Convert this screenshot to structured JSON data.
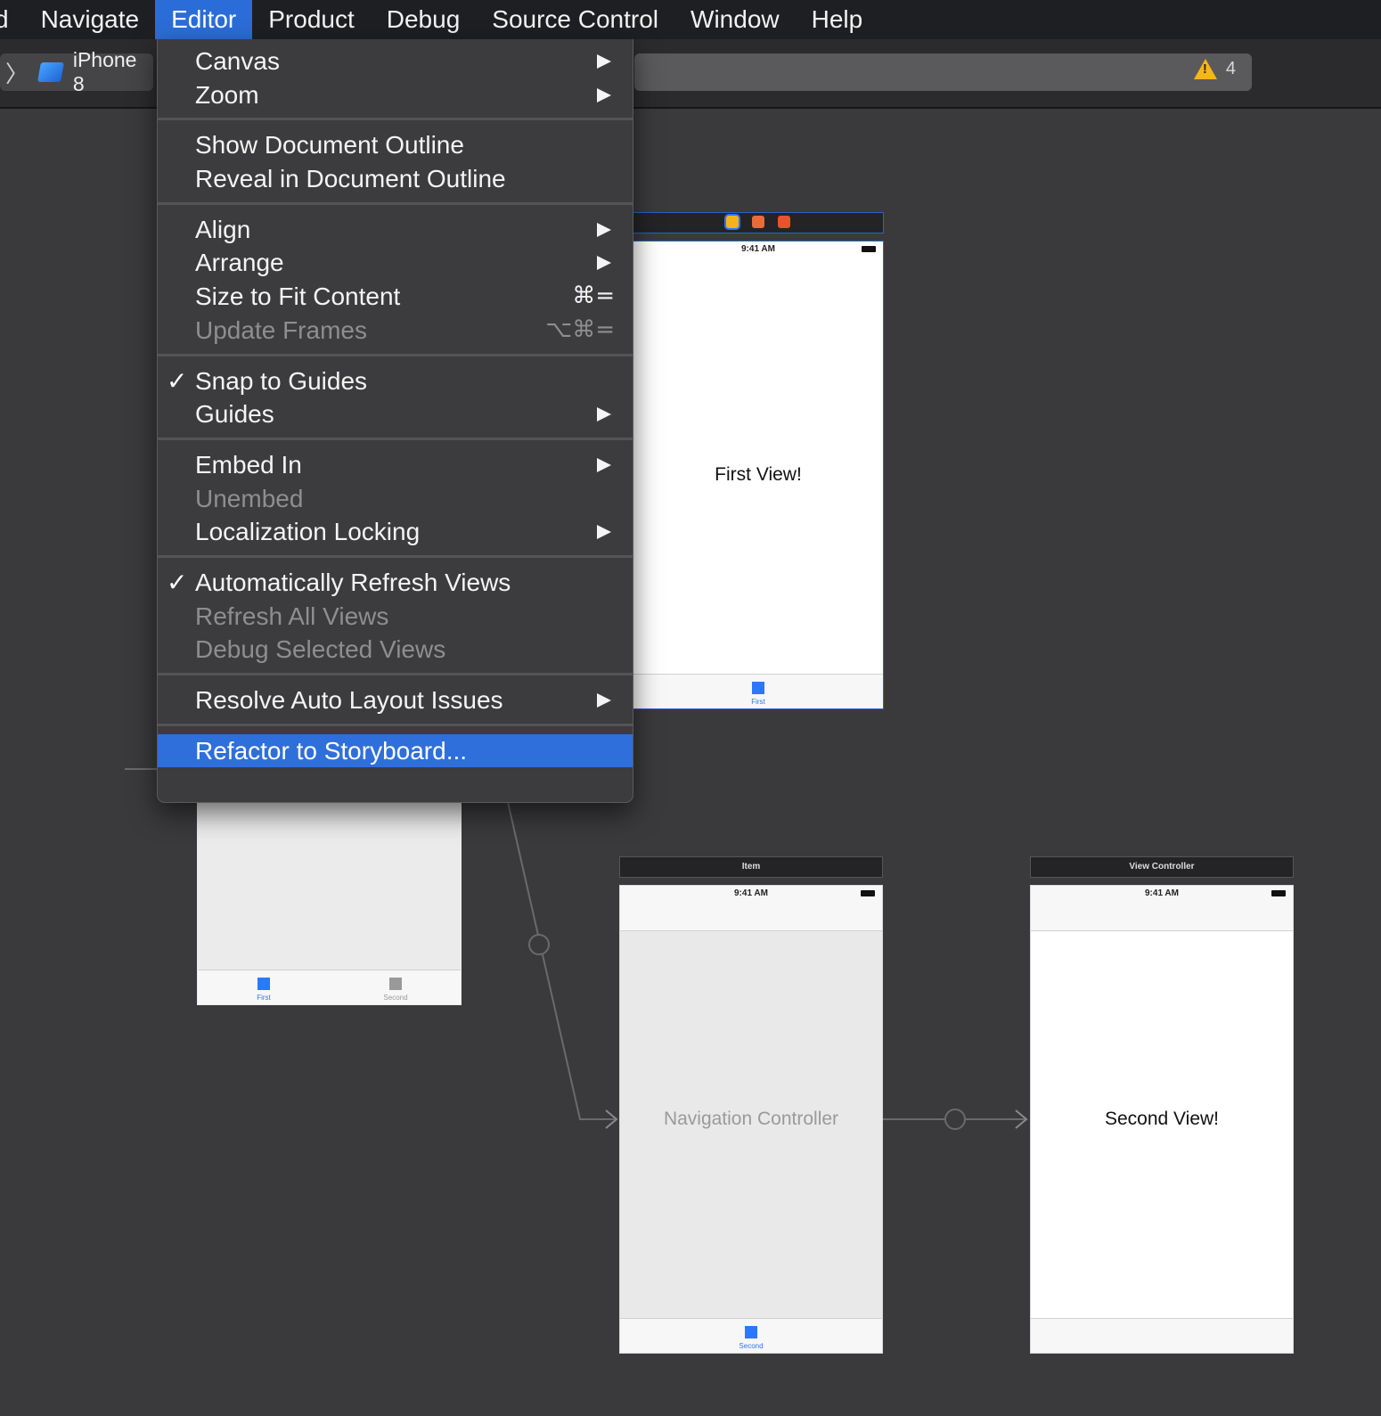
{
  "menubar": {
    "items": [
      {
        "label": "d"
      },
      {
        "label": "Navigate"
      },
      {
        "label": "Editor"
      },
      {
        "label": "Product"
      },
      {
        "label": "Debug"
      },
      {
        "label": "Source Control"
      },
      {
        "label": "Window"
      },
      {
        "label": "Help"
      }
    ]
  },
  "toolbar": {
    "scheme_device": "iPhone 8",
    "warning_count": "4",
    "warning_color": "#f5b617"
  },
  "editor_menu": {
    "canvas": "Canvas",
    "zoom": "Zoom",
    "show_document_outline": "Show Document Outline",
    "reveal_in_document_outline": "Reveal in Document Outline",
    "align": "Align",
    "arrange": "Arrange",
    "size_to_fit_content": "Size to Fit Content",
    "size_to_fit_shortcut": "⌘=",
    "update_frames": "Update Frames",
    "update_frames_shortcut": "⌥⌘=",
    "snap_to_guides": "Snap to Guides",
    "snap_check": "✓",
    "guides": "Guides",
    "embed_in": "Embed In",
    "unembed": "Unembed",
    "localization_locking": "Localization Locking",
    "automatically_refresh_views": "Automatically Refresh Views",
    "auto_refresh_check": "✓",
    "refresh_all_views": "Refresh All Views",
    "debug_selected_views": "Debug Selected Views",
    "resolve_auto_layout_issues": "Resolve Auto Layout Issues",
    "refactor_to_storyboard": "Refactor to Storyboard...",
    "highlight_color": "#2f6fdb"
  },
  "canvas": {
    "first_scene": {
      "time": "9:41 AM",
      "label": "First View!",
      "tab_label": "First"
    },
    "tab_scene": {
      "tab_first": "First",
      "tab_second": "Second"
    },
    "item_scene": {
      "title": "Item",
      "time": "9:41 AM",
      "label": "Navigation Controller",
      "tab_label": "Second"
    },
    "vc_scene": {
      "title": "View Controller",
      "time": "9:41 AM",
      "label": "Second View!"
    },
    "accent_color": "#2b78ff"
  }
}
